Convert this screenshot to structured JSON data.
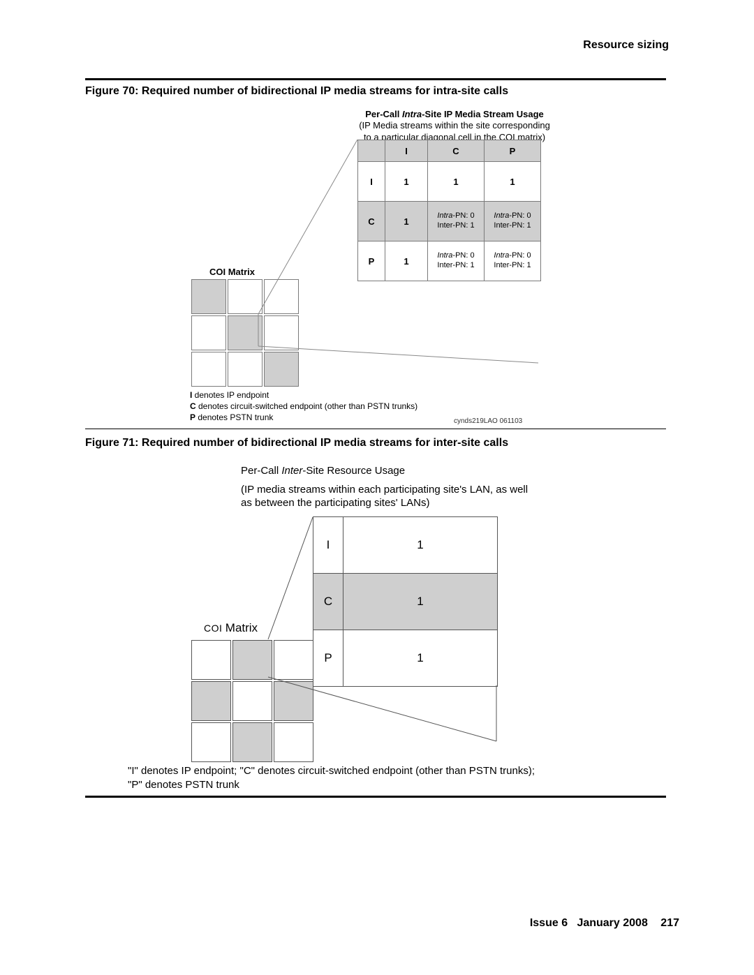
{
  "header": {
    "section": "Resource sizing"
  },
  "figure70": {
    "caption": "Figure 70: Required number of bidirectional IP media streams for intra-site calls",
    "subtitle_prefix": "Per-Call ",
    "subtitle_ital": "Intra",
    "subtitle_suffix": "-Site IP Media Stream Usage",
    "subtitle_line2": "(IP Media streams within the site corresponding",
    "subtitle_line3": "to a particular diagonal cell in the COI matrix)",
    "matrix_label": "COI Matrix",
    "headers": [
      "I",
      "C",
      "P"
    ],
    "row_labels": [
      "I",
      "C",
      "P"
    ],
    "data_I": [
      "1",
      "1",
      "1"
    ],
    "data_C_col1": "1",
    "intra_label": "Intra",
    "pn0": "-PN: 0",
    "inter_label": "Inter-PN: 1",
    "data_P_col1": "1",
    "legend_I_b": "I",
    "legend_I": " denotes IP endpoint",
    "legend_C_b": "C",
    "legend_C": " denotes circuit-switched endpoint (other than PSTN trunks)",
    "legend_P_b": "P",
    "legend_P": " denotes PSTN trunk",
    "refid": "cynds219LAO 061103"
  },
  "figure71": {
    "caption": "Figure 71: Required number of bidirectional IP media streams for inter-site calls",
    "subtitle_prefix": "Per-Call ",
    "subtitle_ital": "Inter",
    "subtitle_suffix": "-Site Resource Usage",
    "subtitle_line2": "(IP media streams within each participating site's LAN, as well",
    "subtitle_line3": "as between the participating sites' LANs)",
    "matrix_label": "Matrix",
    "matrix_label_prefix": "COI ",
    "rows": [
      {
        "label": "I",
        "value": "1"
      },
      {
        "label": "C",
        "value": "1"
      },
      {
        "label": "P",
        "value": "1"
      }
    ],
    "legend_line1": "\"I\" denotes IP endpoint; \"C\" denotes circuit-switched endpoint (other than PSTN trunks);",
    "legend_line2": "\"P\" denotes PSTN trunk"
  },
  "footer": {
    "issue": "Issue 6",
    "date": "January 2008",
    "page": "217"
  }
}
